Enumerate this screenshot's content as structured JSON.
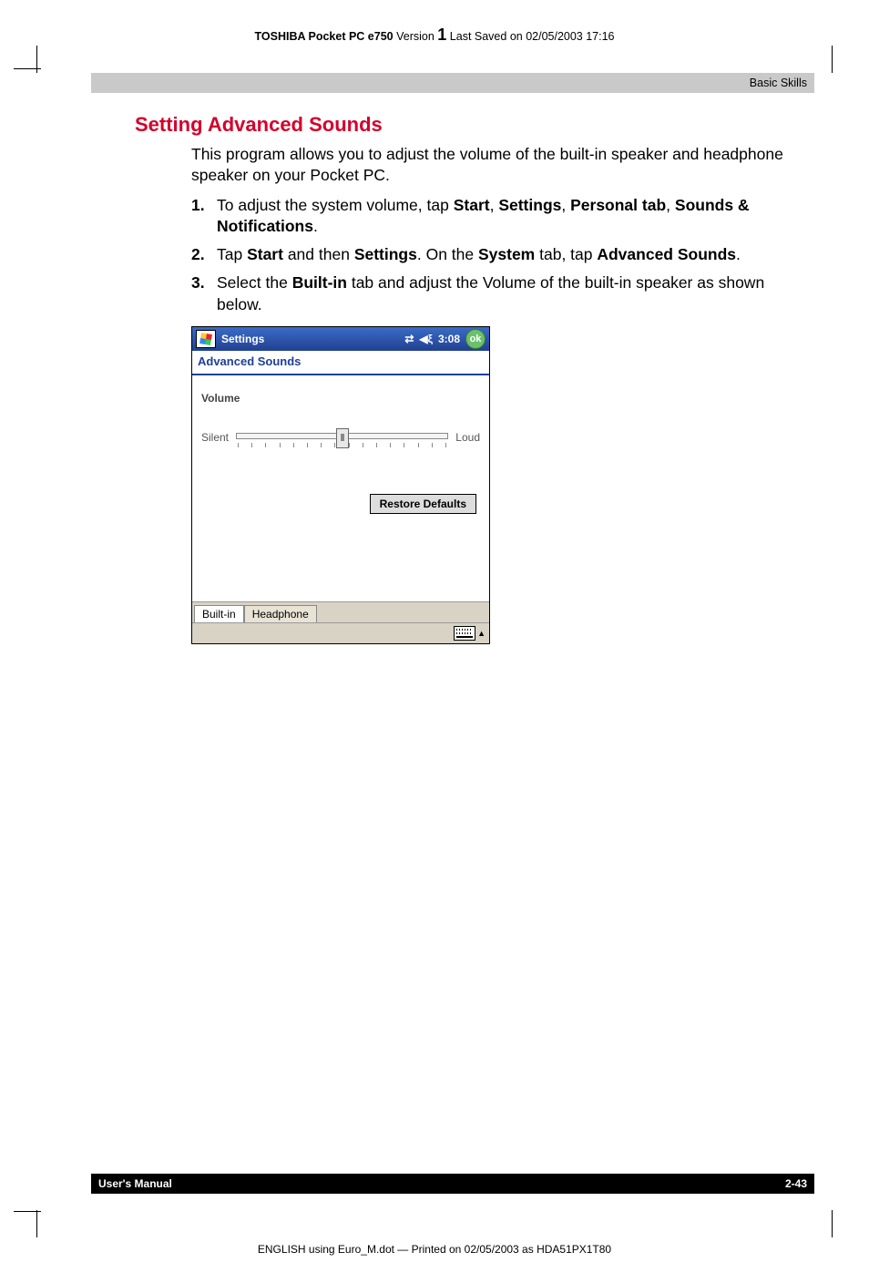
{
  "running_head": {
    "product": "TOSHIBA Pocket PC e750",
    "version_label": "Version",
    "version_num": "1",
    "saved": "Last Saved on 02/05/2003 17:16"
  },
  "topbar": {
    "section": "Basic Skills"
  },
  "section_title": "Setting Advanced Sounds",
  "intro": "This program allows you to adjust the volume of the built-in speaker and headphone speaker on your Pocket PC.",
  "steps": [
    {
      "num": "1.",
      "html": "To adjust the system volume, tap <b>Start</b>, <b>Settings</b>, <b>Personal tab</b>, <b>Sounds & Notifications</b>."
    },
    {
      "num": "2.",
      "html": "Tap <b>Start</b> and then <b>Settings</b>. On the <b>System</b> tab, tap <b>Advanced Sounds</b>."
    },
    {
      "num": "3.",
      "html": "Select the <b>Built-in</b> tab and adjust the Volume of the built-in speaker as shown below."
    }
  ],
  "pocketpc": {
    "title": "Settings",
    "time": "3:08",
    "ok": "ok",
    "subtitle": "Advanced Sounds",
    "volume_label": "Volume",
    "slider_min": "Silent",
    "slider_max": "Loud",
    "restore": "Restore Defaults",
    "tabs": [
      "Built-in",
      "Headphone"
    ]
  },
  "footer": {
    "left": "User's Manual",
    "right": "2-43"
  },
  "print_line": "ENGLISH using Euro_M.dot — Printed on 02/05/2003 as HDA51PX1T80"
}
